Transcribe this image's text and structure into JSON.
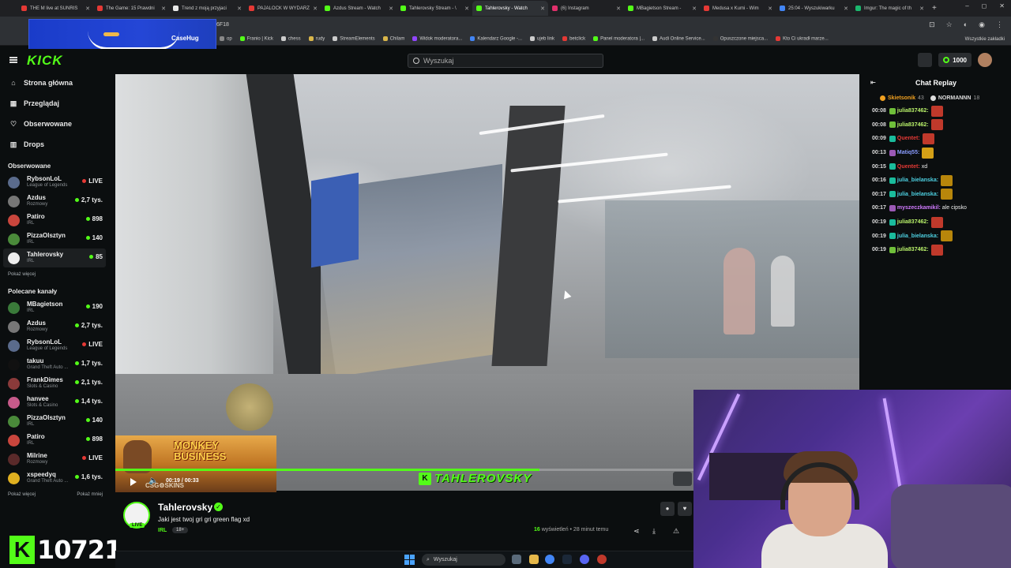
{
  "browser": {
    "tabs": [
      {
        "label": "THE M live at SUNRIS",
        "color": "#e53935"
      },
      {
        "label": "The Game: 15 Prawdni",
        "color": "#e53935"
      },
      {
        "label": "Trend z moją przyjaci",
        "color": "#e8e8e8"
      },
      {
        "label": "PAJALOCK W WYDARZ",
        "color": "#e53935"
      },
      {
        "label": "Azdus Stream - Watch",
        "color": "#53fc18"
      },
      {
        "label": "Tahlerovsky Stream - \\",
        "color": "#53fc18"
      },
      {
        "label": "Tahlerovsky - Watch",
        "color": "#53fc18",
        "active": true
      },
      {
        "label": "(6) Instagram",
        "color": "#e1306c"
      },
      {
        "label": "MBagietson Stream - ",
        "color": "#53fc18"
      },
      {
        "label": "Medusa x Kumi - Wim",
        "color": "#e53935"
      },
      {
        "label": "25:04 - Wyszukiwarku",
        "color": "#4285f4"
      },
      {
        "label": "Imgur: The magic of th",
        "color": "#1bb76e"
      }
    ],
    "new_tab": "+",
    "window_controls": [
      "–",
      "◻",
      "✕"
    ],
    "url_fragment": "6F18",
    "bookmarks": [
      {
        "label": "op",
        "color": "#888"
      },
      {
        "label": "Franio | Kick",
        "color": "#53fc18"
      },
      {
        "label": "chess",
        "color": "#ccc"
      },
      {
        "label": "rudy",
        "color": "#d9b64a"
      },
      {
        "label": "StreamElements",
        "color": "#ccc"
      },
      {
        "label": "Chilam",
        "color": "#d9b64a"
      },
      {
        "label": "Widok moderatora...",
        "color": "#9146ff"
      },
      {
        "label": "Kalendarz Google -...",
        "color": "#4285f4"
      },
      {
        "label": "ujeb link",
        "color": "#ccc"
      },
      {
        "label": "betclick",
        "color": "#e53935"
      },
      {
        "label": "Panel moderatora |...",
        "color": "#53fc18"
      },
      {
        "label": "Audi Online Service...",
        "color": "#ccc"
      },
      {
        "label": "Opuszczone miejsca...",
        "color": "#333"
      },
      {
        "label": "Kto Ci ukradł marze...",
        "color": "#e53935"
      }
    ],
    "bookmarks_all": "Wszystkie zakładki"
  },
  "overlay": {
    "brand": "CaseHug"
  },
  "header": {
    "logo": "KICK",
    "search_placeholder": "Wyszukaj",
    "kicks": "1000"
  },
  "sidebar": {
    "nav": [
      {
        "label": "Strona główna",
        "icon": "⌂"
      },
      {
        "label": "Przeglądaj",
        "icon": "▦"
      },
      {
        "label": "Obserwowane",
        "icon": "♡"
      },
      {
        "label": "Drops",
        "icon": "▥"
      }
    ],
    "followed_heading": "Obserwowane",
    "followed": [
      {
        "name": "RybsonLoL",
        "category": "League of Legends",
        "viewers": "LIVE",
        "live": true,
        "color": "#5a6b8c"
      },
      {
        "name": "Azdus",
        "category": "Rozmowy",
        "viewers": "2,7 tys.",
        "color": "#777"
      },
      {
        "name": "Patiro",
        "category": "IRL",
        "viewers": "898",
        "color": "#c9463d"
      },
      {
        "name": "PizzaOlsztyn",
        "category": "IRL",
        "viewers": "140",
        "color": "#4a8a3a"
      },
      {
        "name": "Tahlerovsky",
        "category": "IRL",
        "viewers": "85",
        "color": "#eee",
        "selected": true
      }
    ],
    "show_more": "Pokaż więcej",
    "recommended_heading": "Polecane kanały",
    "recommended": [
      {
        "name": "MBagietson",
        "category": "IRL",
        "viewers": "190",
        "color": "#3a7a3a"
      },
      {
        "name": "Azdus",
        "category": "Rozmowy",
        "viewers": "2,7 tys.",
        "color": "#777"
      },
      {
        "name": "RybsonLoL",
        "category": "League of Legends",
        "viewers": "LIVE",
        "live": true,
        "color": "#5a6b8c"
      },
      {
        "name": "takuu",
        "category": "Grand Theft Auto ...",
        "viewers": "1,7 tys.",
        "color": "#111"
      },
      {
        "name": "FrankDimes",
        "category": "Slots & Casino",
        "viewers": "2,1 tys.",
        "color": "#8a3a3a"
      },
      {
        "name": "hanvee",
        "category": "Slots & Casino",
        "viewers": "1,4 tys.",
        "color": "#c75a8a"
      },
      {
        "name": "PizzaOlsztyn",
        "category": "IRL",
        "viewers": "140",
        "color": "#4a8a3a"
      },
      {
        "name": "Patiro",
        "category": "IRL",
        "viewers": "898",
        "color": "#c9463d"
      },
      {
        "name": "Milrine",
        "category": "Rozmowy",
        "viewers": "LIVE",
        "live": true,
        "color": "#5a2a2a"
      },
      {
        "name": "xspeedyq",
        "category": "Grand Theft Auto ...",
        "viewers": "1,6 tys.",
        "color": "#e0b020"
      }
    ],
    "show_more2": "Pokaż więcej",
    "show_less": "Pokaż mniej"
  },
  "player": {
    "time": "00:19 / 00:33",
    "progress": 0.57,
    "watermark": "TAHLEROVSKY",
    "ad_title_line1": "MONKEY",
    "ad_title_line2": "BUSINESS",
    "ad_brand": "CSG⚙SKINS"
  },
  "channel": {
    "name": "Tahlerovsky",
    "title": "Jaki jest twoj gri gri green flag xd",
    "category": "IRL",
    "age": "18+",
    "live": "LIVE",
    "views_count": "16",
    "views_suffix": " wyświetleń • 28 minut temu"
  },
  "chat": {
    "title": "Chat Replay",
    "pinned": [
      {
        "name": "Skietsonik",
        "count": "43",
        "color": "#f0a020"
      },
      {
        "name": "NORMANNN",
        "count": "18",
        "color": "#ddd"
      }
    ],
    "messages": [
      {
        "ts": "00:08",
        "user": "julia837462",
        "color": "#b9f26a",
        "badge": "#6fbf3a",
        "text": "",
        "emote": "#c0392b"
      },
      {
        "ts": "00:08",
        "user": "julia837462",
        "color": "#b9f26a",
        "badge": "#6fbf3a",
        "text": "",
        "emote": "#c0392b"
      },
      {
        "ts": "00:09",
        "user": "Quentet",
        "color": "#e53935",
        "badge": "#1abc9c",
        "text": "",
        "emote": "#c0392b"
      },
      {
        "ts": "00:13",
        "user": "Matiq55",
        "color": "#8a9cff",
        "badge": "#9b59b6",
        "text": "",
        "emote": "#d4a017"
      },
      {
        "ts": "00:15",
        "user": "Quentet",
        "color": "#e53935",
        "badge": "#1abc9c",
        "text": "xd",
        "emote": ""
      },
      {
        "ts": "00:16",
        "user": "julia_bielanska",
        "color": "#4dd0e1",
        "badge": "#1abc9c",
        "text": "",
        "emote": "#b8860b"
      },
      {
        "ts": "00:17",
        "user": "julia_bielanska",
        "color": "#4dd0e1",
        "badge": "#1abc9c",
        "text": "",
        "emote": "#b8860b"
      },
      {
        "ts": "00:17",
        "user": "myszeczkamikil",
        "color": "#d17bff",
        "badge": "#9b59b6",
        "text": "ale cipsko",
        "emote": ""
      },
      {
        "ts": "00:19",
        "user": "julia837462",
        "color": "#b9f26a",
        "badge": "#1abc9c",
        "text": "",
        "emote": "#c0392b"
      },
      {
        "ts": "00:19",
        "user": "julia_bielanska",
        "color": "#4dd0e1",
        "badge": "#1abc9c",
        "text": "",
        "emote": "#b8860b"
      },
      {
        "ts": "00:19",
        "user": "julia837462",
        "color": "#b9f26a",
        "badge": "#6fbf3a",
        "text": "",
        "emote": "#c0392b"
      }
    ]
  },
  "counter": {
    "letter": "K",
    "value": "10721"
  },
  "taskbar": {
    "search": "Wyszukaj"
  }
}
